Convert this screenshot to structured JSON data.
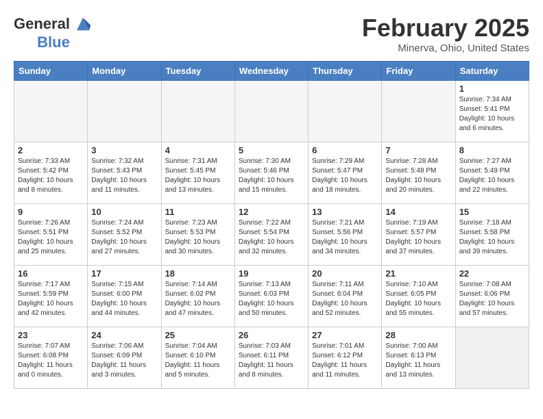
{
  "header": {
    "logo_line1": "General",
    "logo_line2": "Blue",
    "month_title": "February 2025",
    "location": "Minerva, Ohio, United States"
  },
  "weekdays": [
    "Sunday",
    "Monday",
    "Tuesday",
    "Wednesday",
    "Thursday",
    "Friday",
    "Saturday"
  ],
  "weeks": [
    [
      {
        "day": "",
        "info": "",
        "empty": true
      },
      {
        "day": "",
        "info": "",
        "empty": true
      },
      {
        "day": "",
        "info": "",
        "empty": true
      },
      {
        "day": "",
        "info": "",
        "empty": true
      },
      {
        "day": "",
        "info": "",
        "empty": true
      },
      {
        "day": "",
        "info": "",
        "empty": true
      },
      {
        "day": "1",
        "info": "Sunrise: 7:34 AM\nSunset: 5:41 PM\nDaylight: 10 hours\nand 6 minutes."
      }
    ],
    [
      {
        "day": "2",
        "info": "Sunrise: 7:33 AM\nSunset: 5:42 PM\nDaylight: 10 hours\nand 8 minutes."
      },
      {
        "day": "3",
        "info": "Sunrise: 7:32 AM\nSunset: 5:43 PM\nDaylight: 10 hours\nand 11 minutes."
      },
      {
        "day": "4",
        "info": "Sunrise: 7:31 AM\nSunset: 5:45 PM\nDaylight: 10 hours\nand 13 minutes."
      },
      {
        "day": "5",
        "info": "Sunrise: 7:30 AM\nSunset: 5:46 PM\nDaylight: 10 hours\nand 15 minutes."
      },
      {
        "day": "6",
        "info": "Sunrise: 7:29 AM\nSunset: 5:47 PM\nDaylight: 10 hours\nand 18 minutes."
      },
      {
        "day": "7",
        "info": "Sunrise: 7:28 AM\nSunset: 5:48 PM\nDaylight: 10 hours\nand 20 minutes."
      },
      {
        "day": "8",
        "info": "Sunrise: 7:27 AM\nSunset: 5:49 PM\nDaylight: 10 hours\nand 22 minutes."
      }
    ],
    [
      {
        "day": "9",
        "info": "Sunrise: 7:26 AM\nSunset: 5:51 PM\nDaylight: 10 hours\nand 25 minutes."
      },
      {
        "day": "10",
        "info": "Sunrise: 7:24 AM\nSunset: 5:52 PM\nDaylight: 10 hours\nand 27 minutes."
      },
      {
        "day": "11",
        "info": "Sunrise: 7:23 AM\nSunset: 5:53 PM\nDaylight: 10 hours\nand 30 minutes."
      },
      {
        "day": "12",
        "info": "Sunrise: 7:22 AM\nSunset: 5:54 PM\nDaylight: 10 hours\nand 32 minutes."
      },
      {
        "day": "13",
        "info": "Sunrise: 7:21 AM\nSunset: 5:56 PM\nDaylight: 10 hours\nand 34 minutes."
      },
      {
        "day": "14",
        "info": "Sunrise: 7:19 AM\nSunset: 5:57 PM\nDaylight: 10 hours\nand 37 minutes."
      },
      {
        "day": "15",
        "info": "Sunrise: 7:18 AM\nSunset: 5:58 PM\nDaylight: 10 hours\nand 39 minutes."
      }
    ],
    [
      {
        "day": "16",
        "info": "Sunrise: 7:17 AM\nSunset: 5:59 PM\nDaylight: 10 hours\nand 42 minutes."
      },
      {
        "day": "17",
        "info": "Sunrise: 7:15 AM\nSunset: 6:00 PM\nDaylight: 10 hours\nand 44 minutes."
      },
      {
        "day": "18",
        "info": "Sunrise: 7:14 AM\nSunset: 6:02 PM\nDaylight: 10 hours\nand 47 minutes."
      },
      {
        "day": "19",
        "info": "Sunrise: 7:13 AM\nSunset: 6:03 PM\nDaylight: 10 hours\nand 50 minutes."
      },
      {
        "day": "20",
        "info": "Sunrise: 7:11 AM\nSunset: 6:04 PM\nDaylight: 10 hours\nand 52 minutes."
      },
      {
        "day": "21",
        "info": "Sunrise: 7:10 AM\nSunset: 6:05 PM\nDaylight: 10 hours\nand 55 minutes."
      },
      {
        "day": "22",
        "info": "Sunrise: 7:08 AM\nSunset: 6:06 PM\nDaylight: 10 hours\nand 57 minutes."
      }
    ],
    [
      {
        "day": "23",
        "info": "Sunrise: 7:07 AM\nSunset: 6:08 PM\nDaylight: 11 hours\nand 0 minutes."
      },
      {
        "day": "24",
        "info": "Sunrise: 7:06 AM\nSunset: 6:09 PM\nDaylight: 11 hours\nand 3 minutes."
      },
      {
        "day": "25",
        "info": "Sunrise: 7:04 AM\nSunset: 6:10 PM\nDaylight: 11 hours\nand 5 minutes."
      },
      {
        "day": "26",
        "info": "Sunrise: 7:03 AM\nSunset: 6:11 PM\nDaylight: 11 hours\nand 8 minutes."
      },
      {
        "day": "27",
        "info": "Sunrise: 7:01 AM\nSunset: 6:12 PM\nDaylight: 11 hours\nand 11 minutes."
      },
      {
        "day": "28",
        "info": "Sunrise: 7:00 AM\nSunset: 6:13 PM\nDaylight: 11 hours\nand 13 minutes."
      },
      {
        "day": "",
        "info": "",
        "empty": true
      }
    ]
  ]
}
